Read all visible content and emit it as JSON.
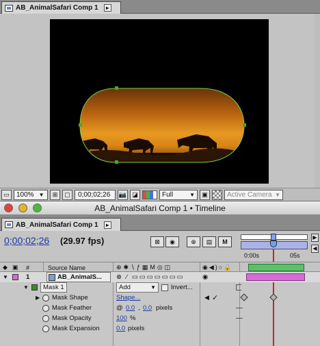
{
  "comp_window": {
    "tab_title": "AB_AnimalSafari Comp 1",
    "tab_menu_icon": "tab-menu-icon"
  },
  "comp_toolbar": {
    "zoom": "100%",
    "timecode": "0;00;02;26",
    "resolution": "Full",
    "camera": "Active Camera"
  },
  "timeline_window": {
    "title": "AB_AnimalSafari Comp 1 • Timeline",
    "tab_title": "AB_AnimalSafari Comp 1",
    "current_time": "0;00;02;26",
    "fps": "(29.97 fps)",
    "ruler": {
      "start": "0:00s",
      "mark": "05s"
    }
  },
  "columns": {
    "hash": "#",
    "source_name": "Source Name"
  },
  "layer": {
    "number": "1",
    "name": "AB_AnimalS...",
    "label_color": "#d66bd8"
  },
  "mask": {
    "name": "Mask 1",
    "mode": "Add",
    "invert_label": "Invert...",
    "color": "#3e8a2a",
    "properties": [
      {
        "name": "Mask Shape",
        "value": "Shape..."
      },
      {
        "name": "Mask Feather",
        "value_a": "0.0",
        "value_b": "0.0",
        "unit": "pixels"
      },
      {
        "name": "Mask Opacity",
        "value": "100",
        "unit": "%"
      },
      {
        "name": "Mask Expansion",
        "value": "0.0",
        "unit": "pixels"
      }
    ]
  },
  "colors": {
    "accent": "#1f3aa0",
    "playhead": "#c0282b",
    "work_area": "#aab2e8",
    "mask_path": "#7fd04a",
    "layer_bar": "#d66bd8"
  }
}
